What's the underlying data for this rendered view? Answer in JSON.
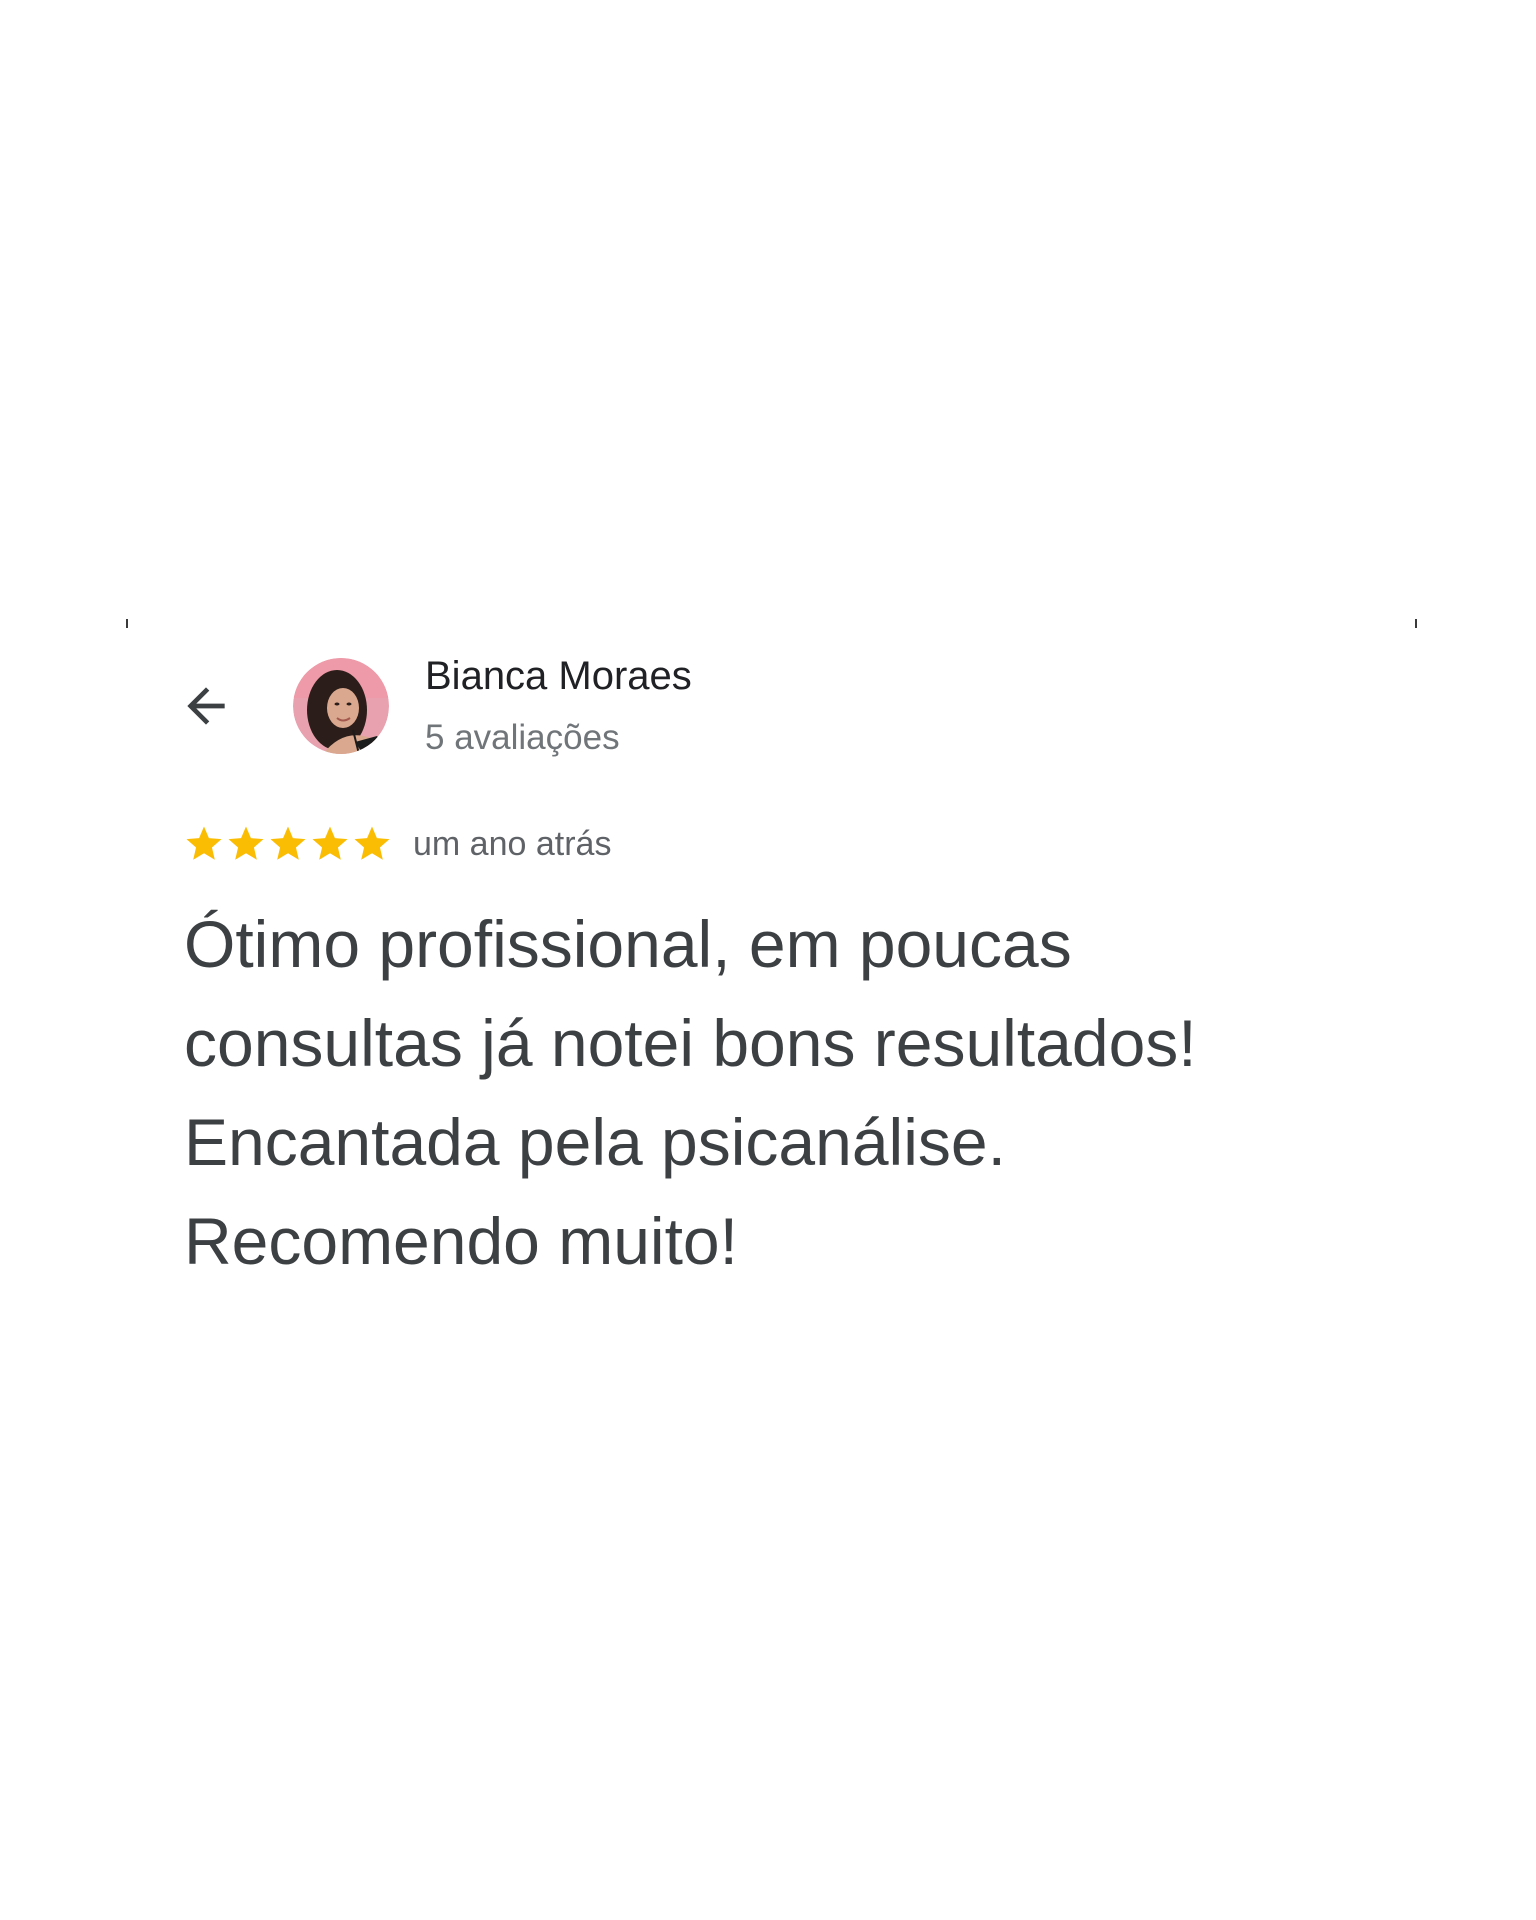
{
  "reviewer": {
    "name": "Bianca Moraes",
    "review_count": "5 avaliações",
    "avatar_icon": "profile-photo"
  },
  "review": {
    "rating": 5,
    "max_rating": 5,
    "star_color": "#fbbc04",
    "date": "um ano atrás",
    "text_lines": [
      "Ótimo profissional, em poucas",
      "consultas já notei bons resultados!",
      "Encantada pela psicanálise.",
      "Recomendo muito!"
    ]
  },
  "icons": {
    "back": "arrow-back-icon",
    "star": "star-icon"
  },
  "colors": {
    "name_text": "#202124",
    "secondary_text": "#70757a",
    "body_text": "#3c4043"
  }
}
